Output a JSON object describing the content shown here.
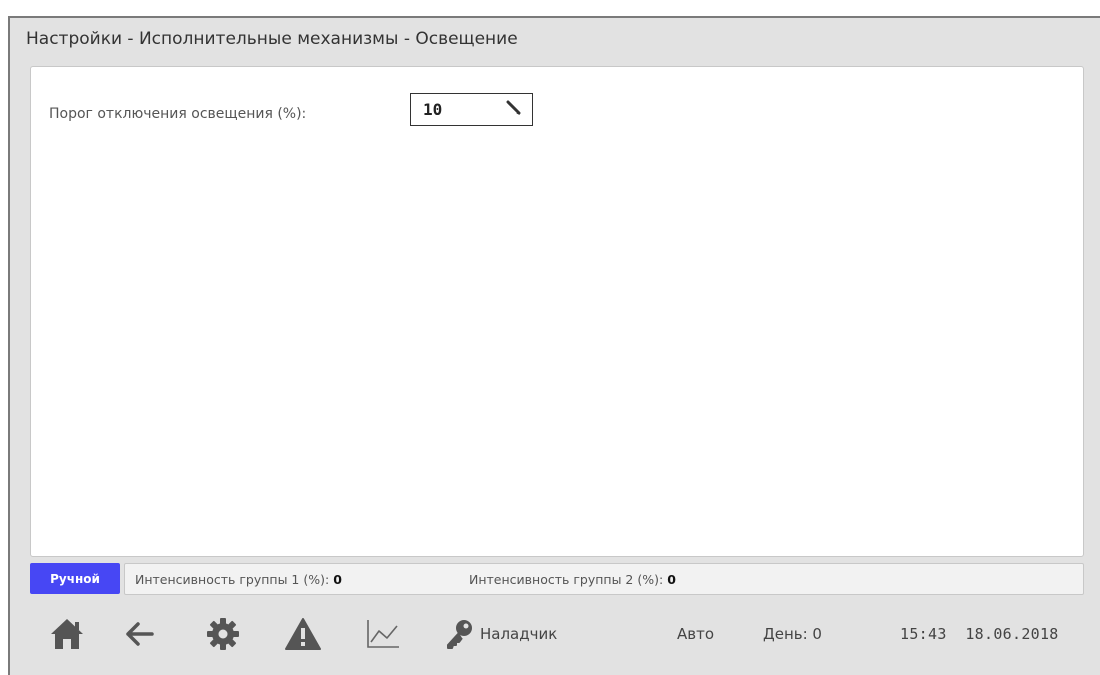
{
  "header": {
    "title": "Настройки - Исполнительные механизмы - Освещение"
  },
  "settings": {
    "threshold_label": "Порог отключения освещения (%):",
    "threshold_value": "10",
    "edit_icon": "pencil-icon"
  },
  "status": {
    "mode_badge": "Ручной",
    "mode_badge_color": "#4747f4",
    "group1_label": "Интенсивность группы 1 (%):",
    "group1_value": "0",
    "group2_label": "Интенсивность группы 2 (%):",
    "group2_value": "0"
  },
  "navbar": {
    "icons": [
      "home-icon",
      "arrow-left-icon",
      "gear-icon",
      "warning-icon",
      "chart-line-icon",
      "key-icon"
    ],
    "user": "Наладчик",
    "mode": "Авто",
    "day": "День: 0",
    "time": "15:43",
    "date": "18.06.2018"
  },
  "colors": {
    "icon": "#555555",
    "background": "#e2e2e2"
  }
}
